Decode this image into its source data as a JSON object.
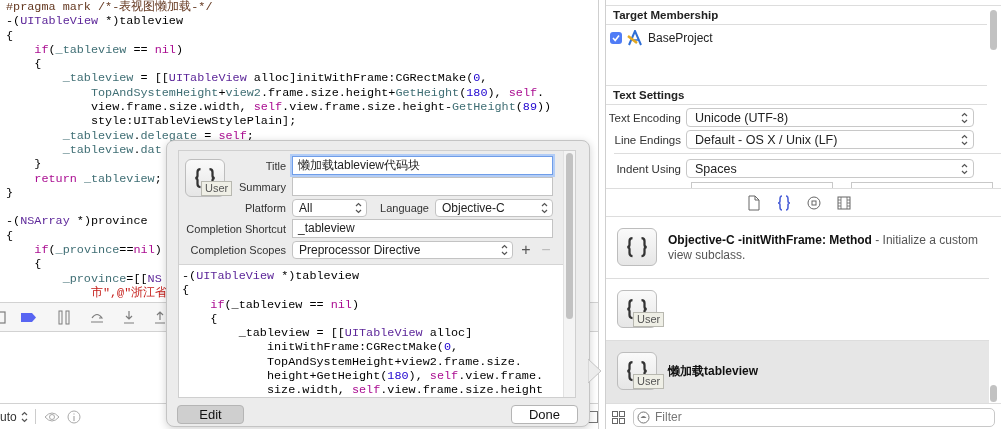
{
  "editor": {
    "lines": [
      {
        "kind": "code",
        "segments": [
          {
            "kind": "pragma",
            "text": "#pragma mark /*-表视图懒加载-*/"
          }
        ]
      },
      {
        "kind": "code",
        "segments": [
          {
            "kind": "plain",
            "text": "-("
          },
          {
            "kind": "type",
            "text": "UITableView"
          },
          {
            "kind": "plain",
            "text": " *)tableview"
          }
        ]
      },
      {
        "kind": "code",
        "segments": [
          {
            "kind": "plain",
            "text": "{"
          }
        ]
      },
      {
        "kind": "code",
        "segments": [
          {
            "kind": "keyword",
            "text": "    if"
          },
          {
            "kind": "plain",
            "text": "("
          },
          {
            "kind": "ident",
            "text": "_tableview"
          },
          {
            "kind": "plain",
            "text": " == "
          },
          {
            "kind": "keyword",
            "text": "nil"
          },
          {
            "kind": "plain",
            "text": ")"
          }
        ]
      },
      {
        "kind": "code",
        "segments": [
          {
            "kind": "plain",
            "text": "    {"
          }
        ]
      },
      {
        "kind": "code",
        "segments": [
          {
            "kind": "ident",
            "text": "        _tableview"
          },
          {
            "kind": "plain",
            "text": " = [["
          },
          {
            "kind": "type",
            "text": "UITableView"
          },
          {
            "kind": "plain",
            "text": " alloc]initWithFrame:CGRectMake("
          },
          {
            "kind": "number",
            "text": "0"
          },
          {
            "kind": "plain",
            "text": ","
          }
        ]
      },
      {
        "kind": "code",
        "segments": [
          {
            "kind": "ident",
            "text": "            TopAndSystemHeight"
          },
          {
            "kind": "plain",
            "text": "+"
          },
          {
            "kind": "ident",
            "text": "view2"
          },
          {
            "kind": "plain",
            "text": ".frame.size.height+"
          },
          {
            "kind": "ident",
            "text": "GetHeight"
          },
          {
            "kind": "plain",
            "text": "("
          },
          {
            "kind": "number",
            "text": "180"
          },
          {
            "kind": "plain",
            "text": "), "
          },
          {
            "kind": "keyword",
            "text": "self"
          },
          {
            "kind": "plain",
            "text": "."
          }
        ]
      },
      {
        "kind": "code",
        "segments": [
          {
            "kind": "plain",
            "text": "            view.frame.size.width, "
          },
          {
            "kind": "keyword",
            "text": "self"
          },
          {
            "kind": "plain",
            "text": ".view.frame.size.height-"
          },
          {
            "kind": "ident",
            "text": "GetHeight"
          },
          {
            "kind": "plain",
            "text": "("
          },
          {
            "kind": "number",
            "text": "89"
          },
          {
            "kind": "plain",
            "text": "))"
          }
        ]
      },
      {
        "kind": "code",
        "segments": [
          {
            "kind": "plain",
            "text": "            style:UITableViewStylePlain];"
          }
        ]
      },
      {
        "kind": "code",
        "segments": [
          {
            "kind": "ident",
            "text": "        _tableview"
          },
          {
            "kind": "plain",
            "text": "."
          },
          {
            "kind": "ident",
            "text": "delegate"
          },
          {
            "kind": "plain",
            "text": " = "
          },
          {
            "kind": "keyword",
            "text": "self"
          },
          {
            "kind": "plain",
            "text": ";"
          }
        ]
      },
      {
        "kind": "code",
        "segments": [
          {
            "kind": "ident",
            "text": "        _tableview"
          },
          {
            "kind": "plain",
            "text": "."
          },
          {
            "kind": "ident",
            "text": "dat"
          }
        ]
      },
      {
        "kind": "code",
        "segments": [
          {
            "kind": "plain",
            "text": "    }"
          }
        ]
      },
      {
        "kind": "code",
        "segments": [
          {
            "kind": "keyword",
            "text": "    return "
          },
          {
            "kind": "ident",
            "text": "_tableview"
          },
          {
            "kind": "plain",
            "text": ";"
          }
        ]
      },
      {
        "kind": "code",
        "segments": [
          {
            "kind": "plain",
            "text": "}"
          }
        ]
      },
      {
        "kind": "blank"
      },
      {
        "kind": "code",
        "segments": [
          {
            "kind": "plain",
            "text": "-("
          },
          {
            "kind": "type",
            "text": "NSArray"
          },
          {
            "kind": "plain",
            "text": " *)province"
          }
        ]
      },
      {
        "kind": "code",
        "segments": [
          {
            "kind": "plain",
            "text": "{"
          }
        ]
      },
      {
        "kind": "code",
        "segments": [
          {
            "kind": "keyword",
            "text": "    if"
          },
          {
            "kind": "plain",
            "text": "("
          },
          {
            "kind": "ident",
            "text": "_province"
          },
          {
            "kind": "plain",
            "text": "=="
          },
          {
            "kind": "keyword",
            "text": "nil"
          },
          {
            "kind": "plain",
            "text": ")"
          }
        ]
      },
      {
        "kind": "code",
        "segments": [
          {
            "kind": "plain",
            "text": "    {"
          }
        ]
      },
      {
        "kind": "code",
        "segments": [
          {
            "kind": "ident",
            "text": "        _province"
          },
          {
            "kind": "plain",
            "text": "=[["
          },
          {
            "kind": "type",
            "text": "NS"
          }
        ]
      },
      {
        "kind": "code",
        "segments": [
          {
            "kind": "string",
            "text": "            市\",@\"浙江省"
          }
        ]
      }
    ]
  },
  "editor_bottom": {
    "scheme_text": "uto"
  },
  "popup": {
    "icon_badge": "User",
    "rows": [
      {
        "kind": "text",
        "label": "Title",
        "value": "懒加载tableview代码块",
        "focused": true
      },
      {
        "kind": "text",
        "label": "Summary",
        "focused": false
      },
      {
        "kind": "selects",
        "label": "Platform",
        "value": "All",
        "second_label": "Language",
        "second_value": "Objective-C"
      },
      {
        "kind": "text",
        "label": "Completion Shortcut",
        "value": "_tableview",
        "focused": false
      },
      {
        "kind": "scope",
        "label": "Completion Scopes",
        "value": "Preprocessor Directive",
        "add": "+",
        "remove": "−",
        "remove_disabled": true
      }
    ],
    "code": {
      "lines": [
        {
          "kind": "code",
          "segments": [
            {
              "kind": "plain",
              "text": "-("
            },
            {
              "kind": "type",
              "text": "UITableView"
            },
            {
              "kind": "plain",
              "text": " *)tableview"
            }
          ]
        },
        {
          "kind": "code",
          "segments": [
            {
              "kind": "plain",
              "text": "{"
            }
          ]
        },
        {
          "kind": "code",
          "segments": [
            {
              "kind": "keyword",
              "text": "    if"
            },
            {
              "kind": "plain",
              "text": "(_tableview == "
            },
            {
              "kind": "keyword",
              "text": "nil"
            },
            {
              "kind": "plain",
              "text": ")"
            }
          ]
        },
        {
          "kind": "code",
          "segments": [
            {
              "kind": "plain",
              "text": "    {"
            }
          ]
        },
        {
          "kind": "code",
          "segments": [
            {
              "kind": "plain",
              "text": "        _tableview = [["
            },
            {
              "kind": "type",
              "text": "UITableView"
            },
            {
              "kind": "plain",
              "text": " alloc]"
            }
          ]
        },
        {
          "kind": "code",
          "segments": [
            {
              "kind": "plain",
              "text": "            initWithFrame:CGRectMake("
            },
            {
              "kind": "number",
              "text": "0"
            },
            {
              "kind": "plain",
              "text": ","
            }
          ]
        },
        {
          "kind": "code",
          "segments": [
            {
              "kind": "plain",
              "text": "            TopAndSystemHeight+view2.frame.size."
            }
          ]
        },
        {
          "kind": "code",
          "segments": [
            {
              "kind": "plain",
              "text": "            height+GetHeight("
            },
            {
              "kind": "number",
              "text": "180"
            },
            {
              "kind": "plain",
              "text": "), "
            },
            {
              "kind": "keyword",
              "text": "self"
            },
            {
              "kind": "plain",
              "text": ".view.frame."
            }
          ]
        },
        {
          "kind": "code",
          "segments": [
            {
              "kind": "plain",
              "text": "            size.width, "
            },
            {
              "kind": "keyword",
              "text": "self"
            },
            {
              "kind": "plain",
              "text": ".view.frame.size.height"
            }
          ]
        }
      ]
    },
    "buttons": [
      {
        "label": "Edit",
        "pressed": true
      },
      {
        "label": "Done",
        "pressed": false
      }
    ]
  },
  "inspector": {
    "target_membership": {
      "title": "Target Membership",
      "targets": [
        {
          "name": "BaseProject",
          "checked": true
        }
      ]
    },
    "text_settings": {
      "title": "Text Settings",
      "rows": [
        {
          "label": "Text Encoding",
          "value": "Unicode (UTF-8)",
          "separator_before": false
        },
        {
          "label": "Line Endings",
          "value": "Default - OS X / Unix (LF)",
          "separator_before": false
        },
        {
          "label": "Indent Using",
          "value": "Spaces",
          "separator_before": true
        }
      ]
    }
  },
  "library": {
    "tabs": [
      {
        "kind": "file",
        "selected": false
      },
      {
        "kind": "braces",
        "selected": true
      },
      {
        "kind": "object",
        "selected": false
      },
      {
        "kind": "media",
        "selected": false
      }
    ],
    "items": [
      {
        "title": "Objective-C -initWithFrame: Method",
        "description": "- Initialize a custom view subclass.",
        "selected": false
      },
      {
        "badge": "User",
        "selected": false
      },
      {
        "title": "懒加载tableview",
        "badge": "User",
        "selected": true
      }
    ],
    "filter": {
      "placeholder": "Filter"
    }
  }
}
